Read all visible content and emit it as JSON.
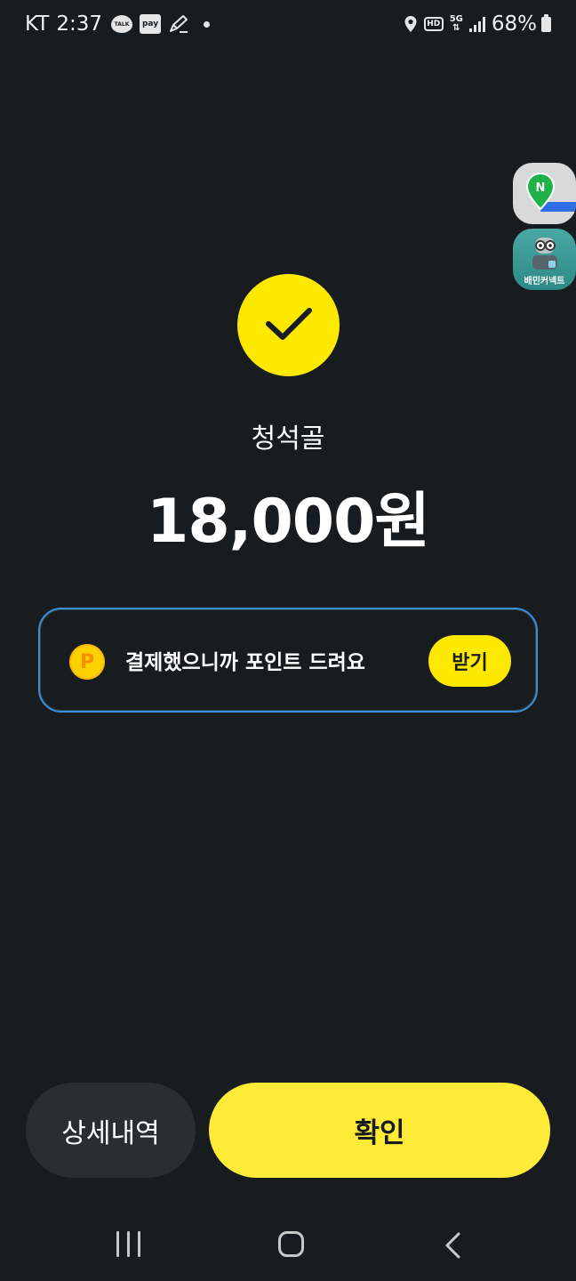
{
  "status_bar": {
    "carrier": "KT",
    "time": "2:37",
    "talk_badge": "TALK",
    "pay_badge": "pay",
    "hd_badge": "HD",
    "network": "5G",
    "battery": "68%"
  },
  "floating_apps": {
    "baemin_label": "배민커넥트"
  },
  "payment": {
    "merchant": "청석골",
    "amount": "18,000원"
  },
  "point_card": {
    "coin_symbol": "P",
    "message": "결제했으니까 포인트 드려요",
    "button_label": "받기"
  },
  "actions": {
    "details_label": "상세내역",
    "confirm_label": "확인"
  },
  "colors": {
    "background": "#191c1f",
    "accent_yellow": "#fde800",
    "card_border": "#3d8ed9",
    "secondary_button": "#2a2d31"
  },
  "icons": {
    "success": "check-icon",
    "point": "point-coin-icon",
    "nav": [
      "recent-apps-icon",
      "home-icon",
      "back-icon"
    ]
  }
}
